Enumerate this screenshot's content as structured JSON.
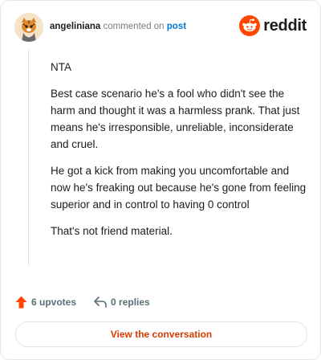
{
  "comment": {
    "author": "angeliniana",
    "verb": "commented on",
    "target_link": "post",
    "paragraphs": [
      "NTA",
      "Best case scenario he's a fool who didn't see the harm and thought it was a harmless prank. That just means he's irresponsible, unreliable, inconsiderate and cruel.",
      "He got a kick from making you uncomfortable and now he's freaking out because he's gone from feeling superior and in control to having 0 control",
      "That's not friend material."
    ]
  },
  "brand": {
    "name": "reddit",
    "icon": "reddit-snoo-icon",
    "color": "#ff4500"
  },
  "actions": {
    "upvotes_label": "6 upvotes",
    "upvote_icon": "upvote-arrow-icon",
    "replies_label": "0 replies",
    "reply_icon": "reply-arrow-icon"
  },
  "cta": {
    "label": "View the conversation"
  },
  "colors": {
    "accent": "#d93a00",
    "link": "#0079d3",
    "upvote": "#ff4500"
  }
}
